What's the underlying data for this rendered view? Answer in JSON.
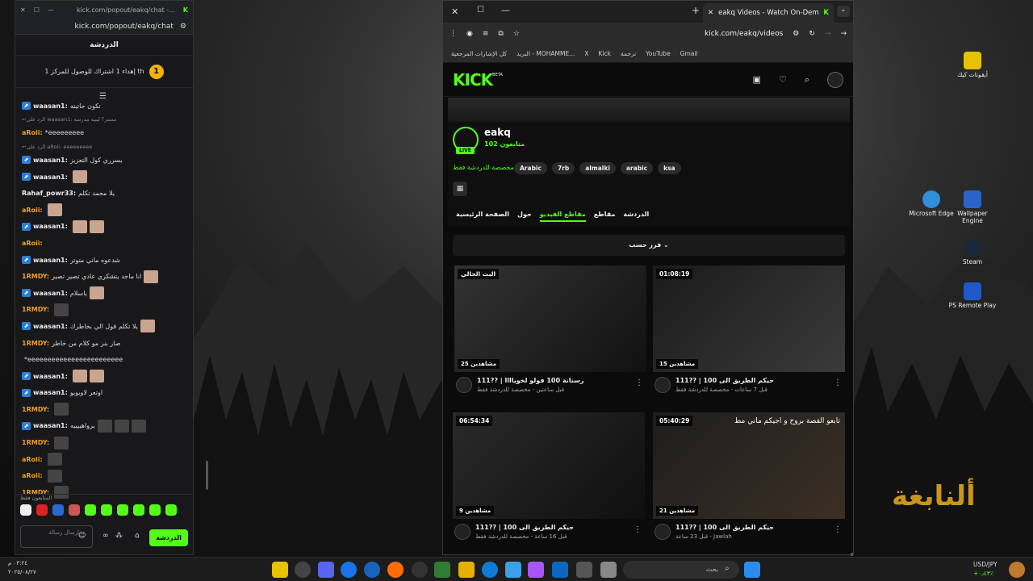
{
  "chat_window": {
    "tab_title": "kick.com/popout/eakq/chat -...",
    "url": "kick.com/popout/eakq/chat",
    "header": "الدردشة",
    "goal_text": "إهداء 1 اشتراك للوصول للمركز 1 th",
    "goal_rank": "1",
    "messages": [
      {
        "user": "waasan1:",
        "text": "تكون حاتيته",
        "color": "#eee",
        "icon": true
      },
      {
        "reply": "الرد على waasan1: مستر؟ ليبيه مدرسه"
      },
      {
        "user": "aRoii:",
        "text": "*eeeeeeeee",
        "color": "#f0a020"
      },
      {
        "reply": "الرد على aRoii: eeeeeeeee"
      },
      {
        "user": "waasan1:",
        "text": "يسرري كول التعزيز",
        "color": "#eee",
        "icon": true
      },
      {
        "user": "waasan1:",
        "text": "",
        "color": "#eee",
        "icon": true,
        "emotes": 1
      },
      {
        "user": "Rahaf_powr33:",
        "text": "يلا محمد تكلم",
        "color": "#eee"
      },
      {
        "user": "aRoii:",
        "text": "",
        "color": "#f0a020",
        "emotes": 1
      },
      {
        "user": "waasan1:",
        "text": "",
        "color": "#eee",
        "icon": true,
        "emotes": 2
      },
      {
        "user": "aRoii:",
        "text": "",
        "color": "#f0a020"
      },
      {
        "user": "waasan1:",
        "text": "شدعوه ماني متوتر",
        "color": "#eee",
        "icon": true
      },
      {
        "user": "1RMDY:",
        "text": "انا ماجد يتشكري عادي تصير تصير",
        "color": "#f0a020",
        "emotes": 1
      },
      {
        "user": "waasan1:",
        "text": "ياسلام",
        "color": "#eee",
        "icon": true,
        "emotes": 1
      },
      {
        "user": "1RMDY:",
        "text": "",
        "color": "#f0a020",
        "emotes": 1,
        "dark": true
      },
      {
        "user": "waasan1:",
        "text": "يلا تكلم قول الي بخاطرك",
        "color": "#eee",
        "icon": true,
        "emotes": 1
      },
      {
        "user": "1RMDY:",
        "text": "صار بنر مو كلام من خاطر",
        "color": "#f0a020"
      },
      {
        "user": "",
        "text": "*eeeeeeeeeeeeeeeeeeeeeeee",
        "color": "#eee"
      },
      {
        "user": "waasan1:",
        "text": "",
        "color": "#eee",
        "icon": true,
        "emotes": 2
      },
      {
        "user": "waasan1:",
        "text": "اوتعر لاوبوبو",
        "color": "#eee",
        "icon": true
      },
      {
        "user": "1RMDY:",
        "text": "",
        "color": "#f0a020",
        "emotes": 1,
        "dark": true
      },
      {
        "user": "waasan1:",
        "text": "يرواهييييه",
        "color": "#eee",
        "icon": true,
        "emotes": 3,
        "dark": true
      },
      {
        "user": "1RMDY:",
        "text": "",
        "color": "#f0a020",
        "emotes": 1,
        "dark": true
      },
      {
        "user": "aRoii:",
        "text": "",
        "color": "#f0a020",
        "emotes": 1,
        "dark": true
      },
      {
        "user": "aRoii:",
        "text": "",
        "color": "#f0a020",
        "emotes": 1,
        "dark": true
      },
      {
        "user": "1RMDY:",
        "text": "",
        "color": "#f0a020",
        "emotes": 1,
        "dark": true
      }
    ],
    "followers_only": "المتابعون فقط",
    "input_placeholder": "إرسال رسالة",
    "chat_button": "الدردشة"
  },
  "browser": {
    "tab_title": "eakq Videos - Watch On-Dema",
    "url": "kick.com/eakq/videos",
    "bookmarks": [
      "Gmail",
      "YouTube",
      "ترجمة",
      "Kick",
      "X",
      "البريد - MOHAMME...",
      "كل الإشارات المرجعية"
    ],
    "accent": "#53fc18"
  },
  "channel": {
    "logo": "KICK",
    "logo_beta": "BETA",
    "name": "eakq",
    "followers": "102 متابعون",
    "live": "LIVE",
    "chat_only": "مخصصة للدردشة فقط",
    "tags": [
      "Arabic",
      "7rb",
      "almalki",
      "arabic",
      "ksa"
    ],
    "tabs": [
      "الصفحة الرئيسية",
      "حول",
      "مقاطع الفيديو",
      "مقاطع",
      "الدردشة"
    ],
    "sort_label": "فرز حسب"
  },
  "videos": [
    {
      "badge": "البث الحالي",
      "viewers": "25 مشاهدين",
      "title": "رسنانة 100 فولو لخوياااا | ??111",
      "meta": "قبل ساعتين - مخصصة للدردشة فقط"
    },
    {
      "badge": "01:08:19",
      "viewers": "15 مشاهدين",
      "title": "حيكم الطريق الى 100 | ??111",
      "meta": "قبل 7 ساعات - مخصصة للدردشة فقط"
    },
    {
      "badge": "06:54:34",
      "viewers": "9 مشاهدين",
      "title": "حيكم الطريق الى 100 | ??111",
      "meta": "قبل 16 ساعة - مخصصة للدردشة فقط"
    },
    {
      "badge": "05:40:29",
      "viewers": "21 مشاهدين",
      "title": "حيكم الطريق الى 100 | ??111",
      "meta": "قبل 23 ساعة - Jawlah",
      "overlay": "تابعو القصة بروح و اجيكم ماني مط"
    }
  ],
  "desktop_icons": [
    "أيقونات كيك",
    "Microsoft Edge",
    "Wallpaper Engine",
    "Steam",
    "PS Remote Play"
  ],
  "taskbar": {
    "search": "بحث",
    "currency": "USD/JPY",
    "currency_val": "+٠٫٤٣٪",
    "time": "٠٣:٢٤ م",
    "date": "٢٠٢٥/٠٨/٢٧"
  }
}
